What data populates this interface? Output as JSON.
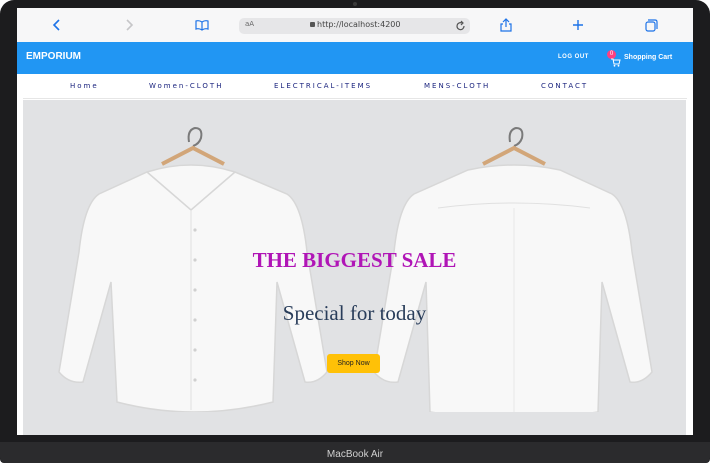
{
  "device": {
    "model_label": "MacBook Air"
  },
  "browser": {
    "address_text_size_label": "aA",
    "url": "http://localhost:4200",
    "icons": [
      "back-icon",
      "forward-icon",
      "reader-icon",
      "lock-icon",
      "reload-icon",
      "share-icon",
      "new-tab-icon",
      "tabs-icon"
    ]
  },
  "navbar": {
    "brand": "EMPORIUM",
    "logout_label": "LOG OUT",
    "cart_count": "0",
    "cart_label": "Shopping Cart",
    "color": "#2196f3"
  },
  "menu": {
    "items": [
      {
        "label": "Home"
      },
      {
        "label": "Women-CLOTH"
      },
      {
        "label": "ELECTRICAL-ITEMS"
      },
      {
        "label": "MENS-CLOTH"
      },
      {
        "label": "CONTACT"
      }
    ]
  },
  "hero": {
    "title": "THE BIGGEST SALE",
    "subtitle": "Special for today",
    "button_label": "Shop Now",
    "title_color": "#b015b6",
    "button_color": "#ffc107"
  }
}
